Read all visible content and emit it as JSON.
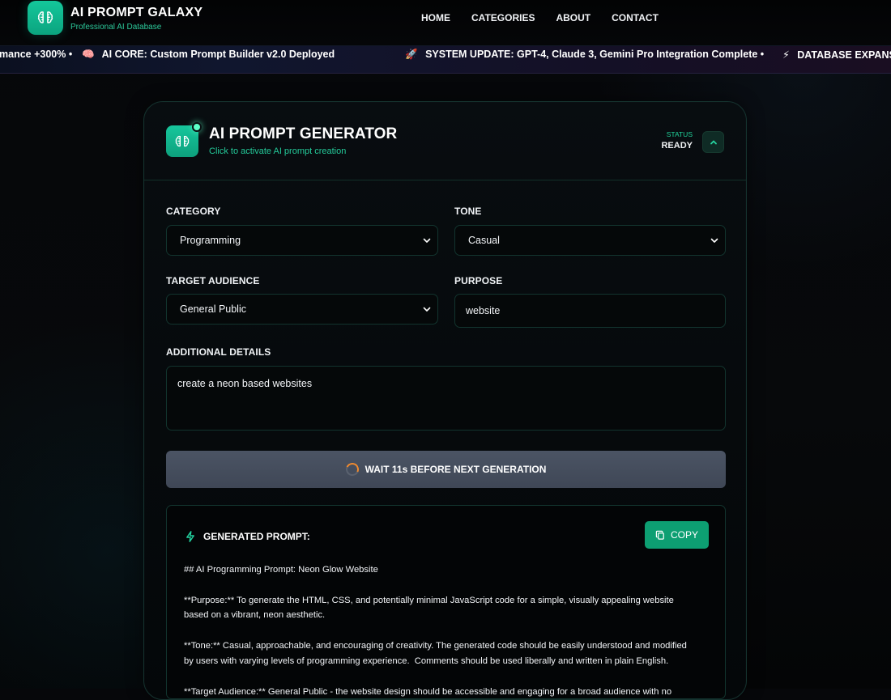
{
  "header": {
    "brand_title": "AI PROMPT GALAXY",
    "brand_subtitle": "Professional AI Database",
    "nav": [
      "HOME",
      "CATEGORIES",
      "ABOUT",
      "CONTACT"
    ]
  },
  "ticker": {
    "items": [
      {
        "icon": "",
        "text": "mance +300% •"
      },
      {
        "icon": "brain-icon",
        "text": "AI CORE: Custom Prompt Builder v2.0 Deployed"
      },
      {
        "icon": "rocket-icon",
        "text": "SYSTEM UPDATE: GPT-4, Claude 3, Gemini Pro Integration Complete •"
      },
      {
        "icon": "bolt-icon",
        "text": "DATABASE EXPANS"
      }
    ]
  },
  "generator": {
    "title": "AI PROMPT GENERATOR",
    "subtitle": "Click to activate AI prompt creation",
    "status_label": "STATUS",
    "status_value": "READY"
  },
  "form": {
    "category_label": "CATEGORY",
    "category_value": "Programming",
    "tone_label": "TONE",
    "tone_value": "Casual",
    "audience_label": "TARGET AUDIENCE",
    "audience_value": "General Public",
    "purpose_label": "PURPOSE",
    "purpose_value": "website",
    "details_label": "ADDITIONAL DETAILS",
    "details_value": "create a neon based websites"
  },
  "actions": {
    "wait_label": "WAIT 11s BEFORE NEXT GENERATION",
    "copy_label": "COPY"
  },
  "output": {
    "heading": "GENERATED PROMPT:",
    "text": "## AI Programming Prompt: Neon Glow Website\n\n**Purpose:** To generate the HTML, CSS, and potentially minimal JavaScript code for a simple, visually appealing website\nbased on a vibrant, neon aesthetic.\n\n**Tone:** Casual, approachable, and encouraging of creativity. The generated code should be easily understood and modified\nby users with varying levels of programming experience.  Comments should be used liberally and written in plain English.\n\n**Target Audience:** General Public - the website design should be accessible and engaging for a broad audience with no"
  },
  "colors": {
    "accent": "#14c79b",
    "button_disabled": "#4b5464",
    "background": "#06070a",
    "ticker_text": "#ffffff",
    "status_green": "#21d39b"
  }
}
